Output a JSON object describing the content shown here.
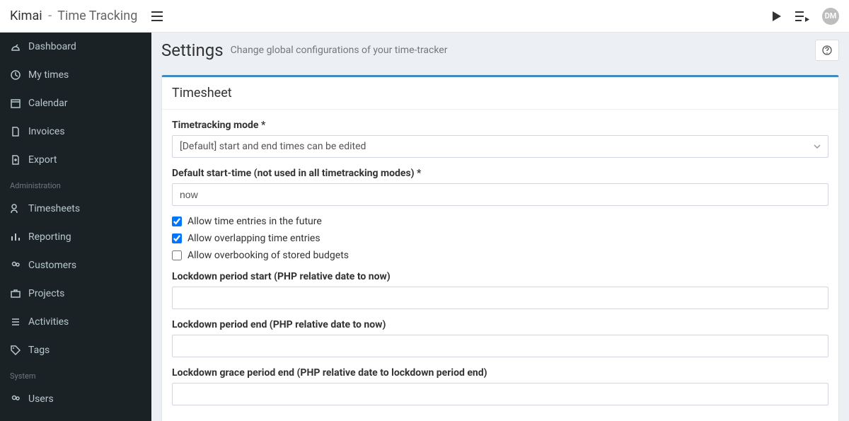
{
  "brand": {
    "app": "Kimai",
    "sep": "-",
    "tag": "Time Tracking"
  },
  "avatar": {
    "initials": "DM"
  },
  "sidebar": {
    "items": [
      {
        "label": "Dashboard"
      },
      {
        "label": "My times"
      },
      {
        "label": "Calendar"
      },
      {
        "label": "Invoices"
      },
      {
        "label": "Export"
      }
    ],
    "section_admin": "Administration",
    "admin_items": [
      {
        "label": "Timesheets"
      },
      {
        "label": "Reporting"
      },
      {
        "label": "Customers"
      },
      {
        "label": "Projects"
      },
      {
        "label": "Activities"
      },
      {
        "label": "Tags"
      }
    ],
    "section_system": "System",
    "system_items": [
      {
        "label": "Users"
      }
    ]
  },
  "page": {
    "title": "Settings",
    "subtitle": "Change global configurations of your time-tracker"
  },
  "panel": {
    "title": "Timesheet",
    "timetracking_mode_label": "Timetracking mode",
    "timetracking_mode_value": "[Default] start and end times can be edited",
    "default_start_label": "Default start-time (not used in all timetracking modes)",
    "default_start_value": "now",
    "check_future": "Allow time entries in the future",
    "check_overlap": "Allow overlapping time entries",
    "check_overbook": "Allow overbooking of stored budgets",
    "lockdown_start_label": "Lockdown period start (PHP relative date to now)",
    "lockdown_start_value": "",
    "lockdown_end_label": "Lockdown period end (PHP relative date to now)",
    "lockdown_end_value": "",
    "lockdown_grace_label": "Lockdown grace period end (PHP relative date to lockdown period end)",
    "lockdown_grace_value": "",
    "required_marker": "*"
  }
}
